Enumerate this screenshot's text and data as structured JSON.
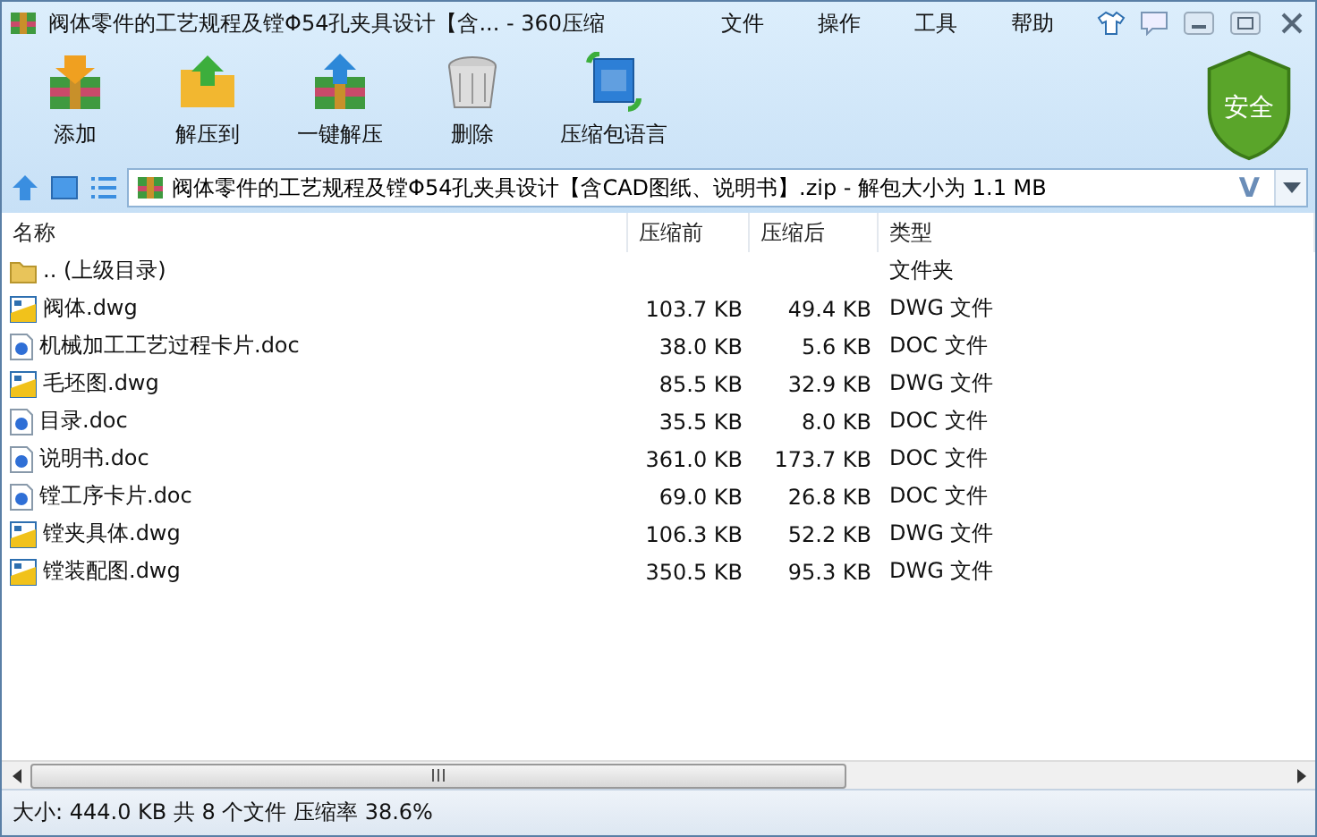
{
  "window": {
    "title": "阀体零件的工艺规程及镗Φ54孔夹具设计【含... - 360压缩"
  },
  "menu": [
    "文件",
    "操作",
    "工具",
    "帮助"
  ],
  "toolbar": [
    {
      "kind": "add",
      "label": "添加"
    },
    {
      "kind": "extract",
      "label": "解压到"
    },
    {
      "kind": "oneclick",
      "label": "一键解压"
    },
    {
      "kind": "delete",
      "label": "删除"
    },
    {
      "kind": "language",
      "label": "压缩包语言"
    }
  ],
  "security_badge": "安全",
  "address": {
    "path": "阀体零件的工艺规程及镗Φ54孔夹具设计【含CAD图纸、说明书】.zip - 解包大小为 1.1 MB",
    "v_mark": "V"
  },
  "table": {
    "columns": [
      "名称",
      "压缩前",
      "压缩后",
      "类型"
    ],
    "rows": [
      {
        "kind": "folder",
        "name": ".. (上级目录)",
        "size": "",
        "packed": "",
        "type": "文件夹"
      },
      {
        "kind": "dwg",
        "name": "阀体.dwg",
        "size": "103.7 KB",
        "packed": "49.4 KB",
        "type": "DWG 文件"
      },
      {
        "kind": "doc",
        "name": "机械加工工艺过程卡片.doc",
        "size": "38.0 KB",
        "packed": "5.6 KB",
        "type": "DOC 文件"
      },
      {
        "kind": "dwg",
        "name": "毛坯图.dwg",
        "size": "85.5 KB",
        "packed": "32.9 KB",
        "type": "DWG 文件"
      },
      {
        "kind": "doc",
        "name": "目录.doc",
        "size": "35.5 KB",
        "packed": "8.0 KB",
        "type": "DOC 文件"
      },
      {
        "kind": "doc",
        "name": "说明书.doc",
        "size": "361.0 KB",
        "packed": "173.7 KB",
        "type": "DOC 文件"
      },
      {
        "kind": "doc",
        "name": "镗工序卡片.doc",
        "size": "69.0 KB",
        "packed": "26.8 KB",
        "type": "DOC 文件"
      },
      {
        "kind": "dwg",
        "name": "镗夹具体.dwg",
        "size": "106.3 KB",
        "packed": "52.2 KB",
        "type": "DWG 文件"
      },
      {
        "kind": "dwg",
        "name": "镗装配图.dwg",
        "size": "350.5 KB",
        "packed": "95.3 KB",
        "type": "DWG 文件"
      }
    ]
  },
  "status_bar": "大小: 444.0 KB 共 8 个文件 压缩率 38.6%"
}
